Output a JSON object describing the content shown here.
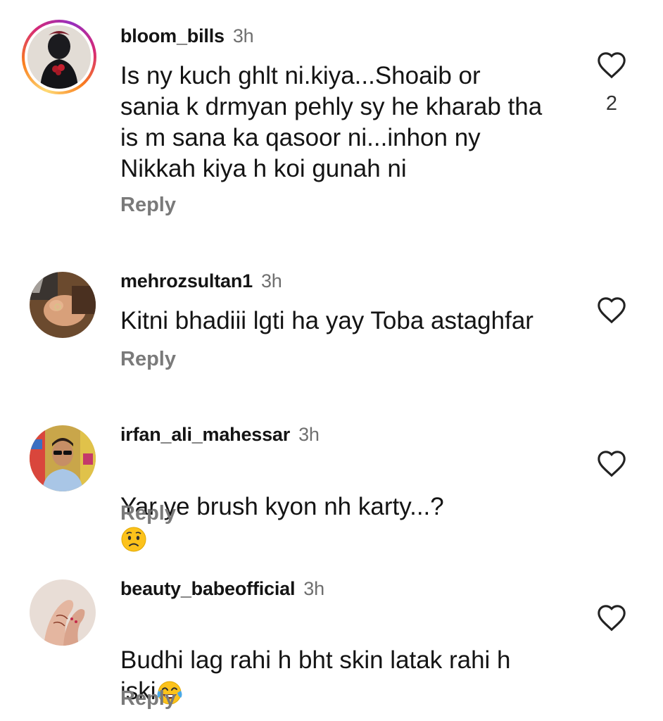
{
  "comments": [
    {
      "username": "bloom_bills",
      "time": "3h",
      "text": "Is ny kuch ghlt ni.kiya...Shoaib  or\nsania k drmyan pehly sy he kharab tha\nis m sana ka qasoor ni...inhon ny\nNikkah kiya h koi gunah ni",
      "reply_label": "Reply",
      "likes": "2",
      "avatar_icon": "avatar-photo-woman-roses",
      "has_story_ring": true
    },
    {
      "username": "mehrozsultan1",
      "time": "3h",
      "text": "Kitni bhadiii lgti ha yay Toba astaghfar",
      "reply_label": "Reply",
      "avatar_icon": "avatar-photo-hand-ring"
    },
    {
      "username": "irfan_ali_mahessar",
      "time": "3h",
      "text": "Yar ye brush kyon nh karty...?",
      "emoji": "worried-face-emoji",
      "reply_label": "Reply",
      "avatar_icon": "avatar-photo-man-sunglasses"
    },
    {
      "username": "beauty_babeofficial",
      "time": "3h",
      "text": "Budhi lag rahi h bht skin latak rahi h\niski",
      "emoji": "tears-of-joy-emoji",
      "reply_label": "Reply",
      "avatar_icon": "avatar-photo-hands-mehndi"
    }
  ],
  "colors": {
    "text": "#141414",
    "secondary": "#6f6f6f",
    "reply": "#7a7a7a",
    "story_ring": [
      "#feda75",
      "#fa7e1e",
      "#d62976",
      "#962fbf"
    ]
  }
}
